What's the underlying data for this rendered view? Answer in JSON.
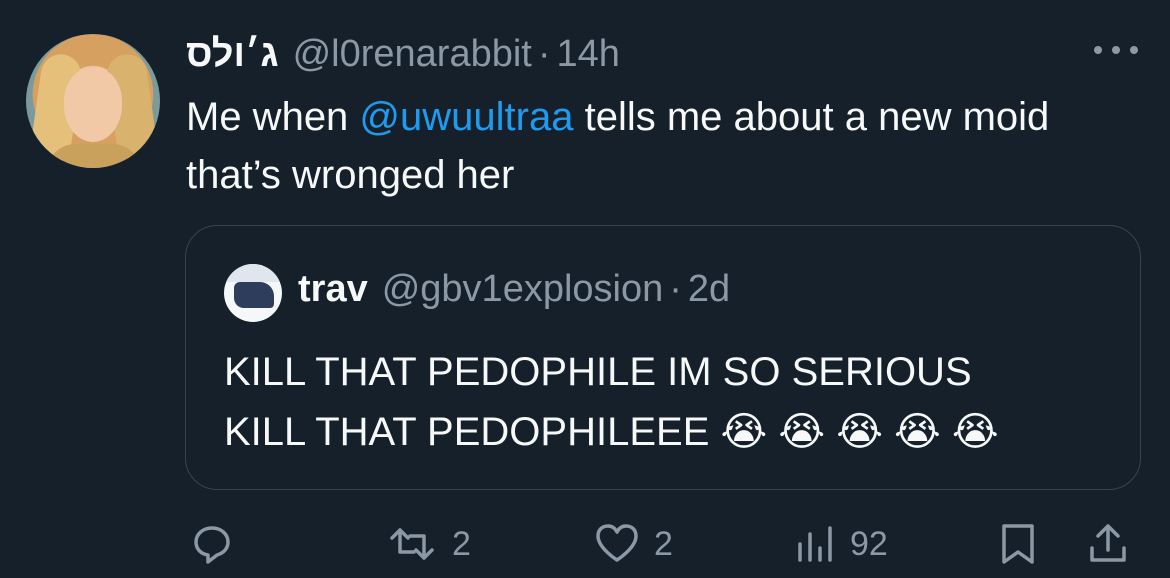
{
  "tweet": {
    "display_name": "ג׳ולס",
    "handle": "@l0renarabbit",
    "separator": "·",
    "time": "14h",
    "text_before": "Me when ",
    "mention": "@uwuultraa",
    "text_after": " tells me about a new moid that’s wronged her"
  },
  "quoted_tweet": {
    "display_name": "trav",
    "handle": "@gbv1explosion",
    "separator": "·",
    "time": "2d",
    "line1": "KILL THAT PEDOPHILE IM SO SERIOUS",
    "line2": "KILL THAT PEDOPHILEEE 😭 😭 😭 😭 😭"
  },
  "actions": {
    "reply_icon": "reply-icon",
    "retweet_count": "2",
    "like_count": "2",
    "views_count": "92",
    "bookmark_icon": "bookmark-icon",
    "share_icon": "share-icon"
  },
  "colors": {
    "background": "#15202b",
    "text": "#f7f9f9",
    "muted": "#8b98a5",
    "accent": "#1d9bf0",
    "border": "#38444d"
  }
}
